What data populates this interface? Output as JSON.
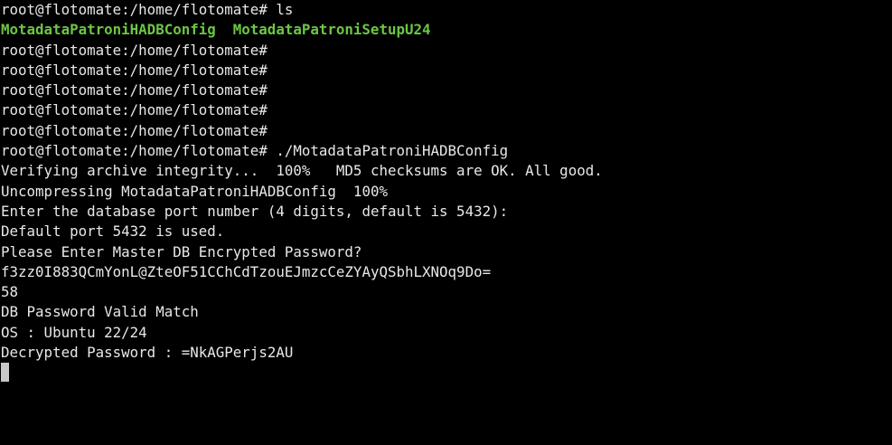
{
  "terminal": {
    "prompt": "root@flotomate:/home/flotomate#",
    "commands": {
      "ls": " ls",
      "run": " ./MotadataPatroniHADBConfig"
    },
    "ls_output": [
      "MotadataPatroniHADBConfig",
      "MotadataPatroniSetupU24"
    ],
    "output_lines": [
      "Verifying archive integrity...  100%   MD5 checksums are OK. All good.",
      "Uncompressing MotadataPatroniHADBConfig  100%",
      "Enter the database port number (4 digits, default is 5432):",
      "Default port 5432 is used.",
      "Please Enter Master DB Encrypted Password?",
      "f3zz0I883QCmYonL@ZteOF51CChCdTzouEJmzcCeZYAyQSbhLXNOq9Do=",
      "58",
      "DB Password Valid Match",
      "OS : Ubuntu 22/24",
      "Decrypted Password : =NkAGPerjs2AU"
    ]
  },
  "colors": {
    "background": "#000000",
    "text": "#e8e8e8",
    "executable": "#6cc644",
    "cursor": "#c8c8c8"
  }
}
